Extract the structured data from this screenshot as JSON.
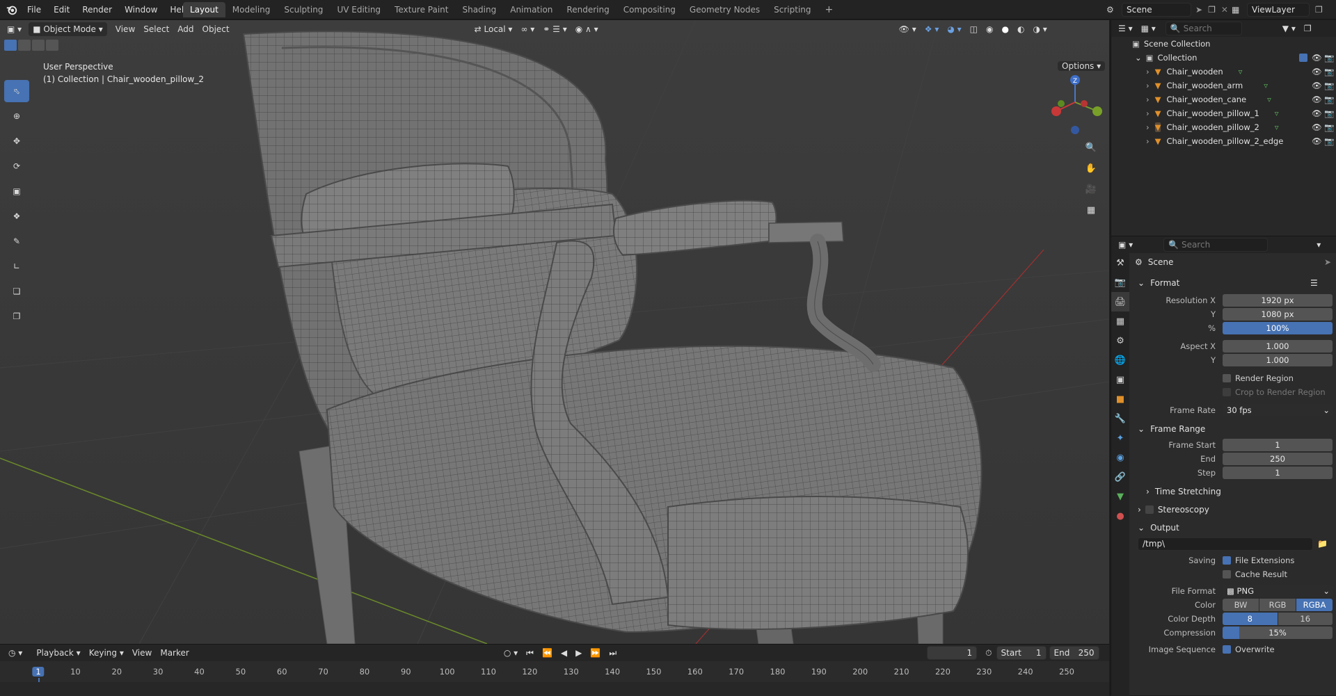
{
  "topbar": {
    "menu": [
      "File",
      "Edit",
      "Render",
      "Window",
      "Help"
    ],
    "workspaces": [
      "Layout",
      "Modeling",
      "Sculpting",
      "UV Editing",
      "Texture Paint",
      "Shading",
      "Animation",
      "Rendering",
      "Compositing",
      "Geometry Nodes",
      "Scripting"
    ],
    "active_workspace": "Layout",
    "plus": "+",
    "scene": "Scene",
    "view_layer": "ViewLayer"
  },
  "viewport": {
    "mode": "Object Mode",
    "menus": [
      "View",
      "Select",
      "Add",
      "Object"
    ],
    "orientation": "Local",
    "perspective": "User Perspective",
    "collection_info": "(1) Collection | Chair_wooden_pillow_2",
    "options": "Options",
    "gizmo_axis_z": "Z",
    "gizmo_axis_x": "X",
    "gizmo_axis_y": "Y"
  },
  "timeline": {
    "menus": [
      "Playback",
      "Keying",
      "View",
      "Marker"
    ],
    "current_frame": "1",
    "start_label": "Start",
    "start": "1",
    "end_label": "End",
    "end": "250",
    "ticks": [
      "1",
      "10",
      "20",
      "30",
      "40",
      "50",
      "60",
      "70",
      "80",
      "90",
      "100",
      "110",
      "120",
      "130",
      "140",
      "150",
      "160",
      "170",
      "180",
      "190",
      "200",
      "210",
      "220",
      "230",
      "240",
      "250"
    ]
  },
  "outliner": {
    "search_placeholder": "Search",
    "scene_collection": "Scene Collection",
    "collection": "Collection",
    "objects": [
      "Chair_wooden",
      "Chair_wooden_arm",
      "Chair_wooden_cane",
      "Chair_wooden_pillow_1",
      "Chair_wooden_pillow_2",
      "Chair_wooden_pillow_2_edge"
    ],
    "active_object": "Chair_wooden_pillow_2"
  },
  "properties": {
    "search_placeholder": "Search",
    "context": "Scene",
    "format": {
      "title": "Format",
      "resolution_x_label": "Resolution X",
      "resolution_x": "1920 px",
      "y_label": "Y",
      "resolution_y": "1080 px",
      "pct_label": "%",
      "pct": "100%",
      "aspect_x_label": "Aspect X",
      "aspect_x": "1.000",
      "aspect_y": "1.000",
      "render_region": "Render Region",
      "crop": "Crop to Render Region",
      "frame_rate_label": "Frame Rate",
      "frame_rate": "30 fps"
    },
    "frame_range": {
      "title": "Frame Range",
      "start_label": "Frame Start",
      "start": "1",
      "end_label": "End",
      "end": "250",
      "step_label": "Step",
      "step": "1"
    },
    "time_stretching": "Time Stretching",
    "stereoscopy": "Stereoscopy",
    "output": {
      "title": "Output",
      "path": "/tmp\\",
      "saving_label": "Saving",
      "file_extensions": "File Extensions",
      "cache_result": "Cache Result",
      "file_format_label": "File Format",
      "file_format": "PNG",
      "color_label": "Color",
      "color_options": [
        "BW",
        "RGB",
        "RGBA"
      ],
      "color_active": "RGBA",
      "depth_label": "Color Depth",
      "depth_options": [
        "8",
        "16"
      ],
      "compression_label": "Compression",
      "compression": "15%",
      "compression_value": 0.15,
      "image_sequence_label": "Image Sequence",
      "overwrite": "Overwrite"
    }
  }
}
